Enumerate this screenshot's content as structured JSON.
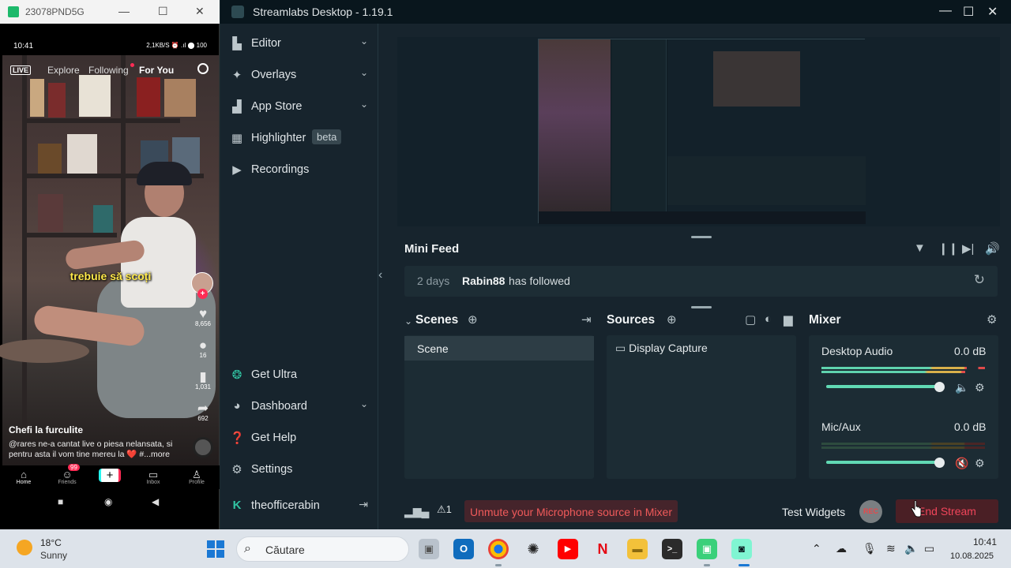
{
  "phone_window": {
    "title": "23078PND5G",
    "status_time": "10:41",
    "status_right": "2,1KB/S ⏰ .ıl ⬤ 100",
    "top_nav": {
      "live": "LIVE",
      "explore": "Explore",
      "following": "Following",
      "for_you": "For You"
    },
    "caption": "trebuie să scoți",
    "side": {
      "likes": "8,656",
      "comments": "16",
      "saves": "1,031",
      "shares": "692"
    },
    "video_title": "Chefi la furculite",
    "video_desc": "@rares ne-a cantat live o piesa nelansata, si pentru asta il vom tine mereu la ❤️ #...more",
    "bottom_nav": {
      "home": "Home",
      "friends": "Friends",
      "friends_badge": "99",
      "inbox": "Inbox",
      "profile": "Profile"
    }
  },
  "streamlabs": {
    "title": "Streamlabs Desktop - 1.19.1",
    "nav": {
      "editor": "Editor",
      "overlays": "Overlays",
      "app_store": "App Store",
      "highlighter": "Highlighter",
      "beta": "beta",
      "recordings": "Recordings",
      "get_ultra": "Get Ultra",
      "dashboard": "Dashboard",
      "get_help": "Get Help",
      "settings": "Settings",
      "user": "theofficerabin"
    },
    "mini_feed": {
      "title": "Mini Feed",
      "ago": "2 days",
      "user": "Rabin88",
      "action": "has followed"
    },
    "scenes": {
      "title": "Scenes",
      "items": [
        "Scene"
      ]
    },
    "sources": {
      "title": "Sources",
      "items": [
        "Display Capture"
      ]
    },
    "mixer": {
      "title": "Mixer",
      "channels": [
        {
          "name": "Desktop Audio",
          "db": "0.0 dB",
          "volume": 0.95
        },
        {
          "name": "Mic/Aux",
          "db": "0.0 dB",
          "volume": 0.95
        }
      ]
    },
    "footer": {
      "alert_count": "1",
      "unmute_msg": "Unmute your Microphone source in Mixer",
      "test_widgets": "Test Widgets",
      "rec": "REC",
      "end_stream": "End Stream"
    }
  },
  "taskbar": {
    "temp": "18°C",
    "weather": "Sunny",
    "search": "Căutare",
    "time": "10:41",
    "date": "10.08.2025"
  }
}
